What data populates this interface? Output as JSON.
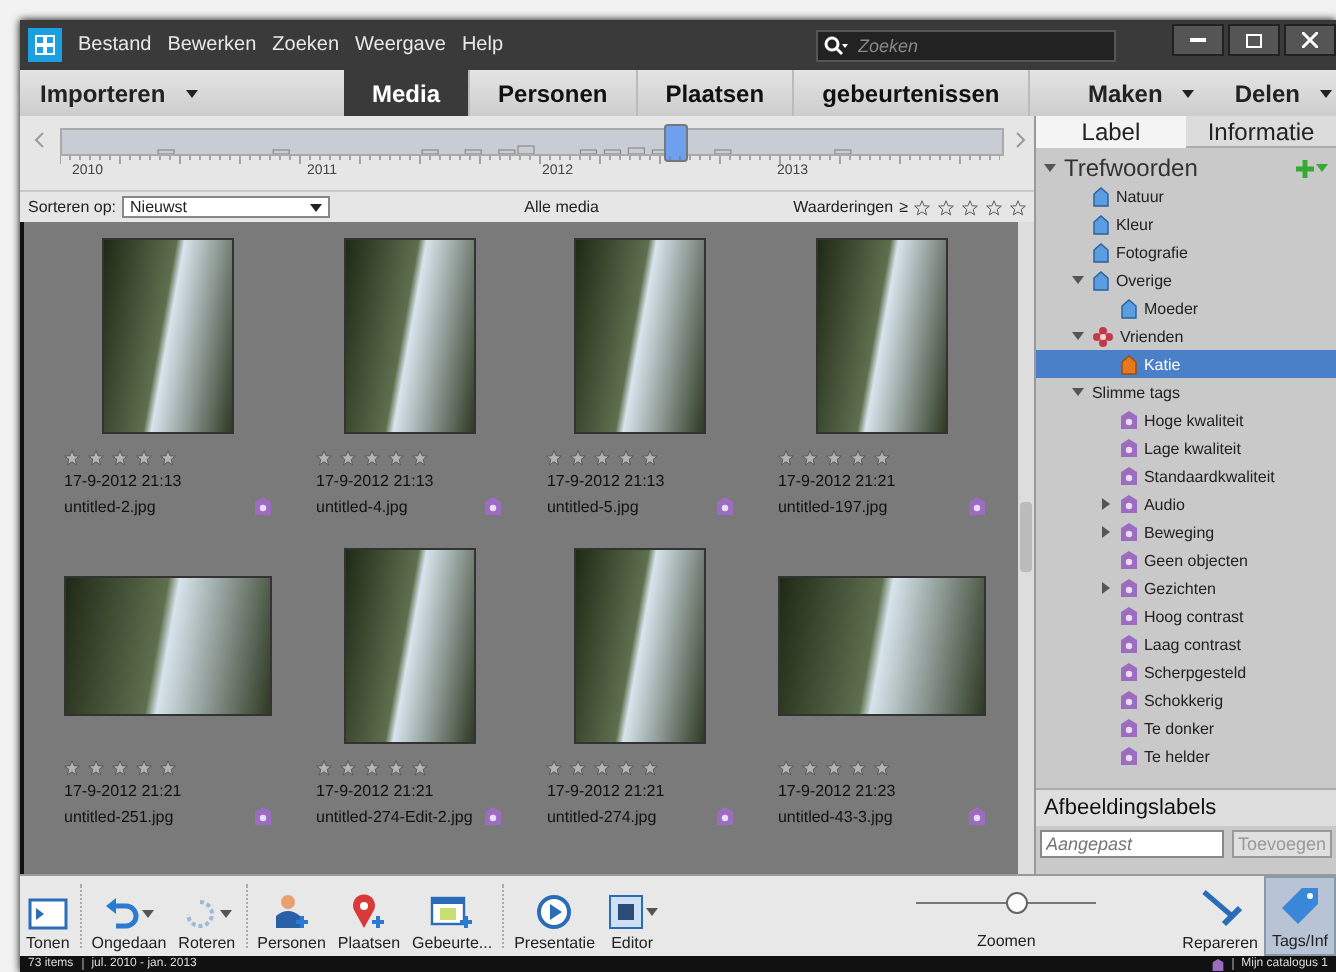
{
  "window": {
    "menu": [
      "Bestand",
      "Bewerken",
      "Zoeken",
      "Weergave",
      "Help"
    ],
    "search": {
      "placeholder": "Zoeken"
    }
  },
  "nav": {
    "import": "Importeren",
    "tabs": [
      {
        "label": "Media",
        "selected": true
      },
      {
        "label": "Personen",
        "selected": false
      },
      {
        "label": "Plaatsen",
        "selected": false
      },
      {
        "label": "gebeurtenissen",
        "selected": false
      }
    ],
    "create": "Maken",
    "share": "Delen"
  },
  "timeline": {
    "years": [
      "2010",
      "2011",
      "2012",
      "2013"
    ],
    "level": 0.65
  },
  "sortbar": {
    "label": "Sorteren op:",
    "sort": "Nieuwst",
    "title": "Alle media",
    "ratings_label": "Waarderingen",
    "ratings_op": "≥",
    "stars": 0
  },
  "media": [
    {
      "kind": "portrait",
      "stars": 0,
      "date": "17-9-2012 21:13",
      "file": "untitled-2.jpg"
    },
    {
      "kind": "portrait",
      "stars": 0,
      "date": "17-9-2012 21:13",
      "file": "untitled-4.jpg"
    },
    {
      "kind": "portrait",
      "stars": 0,
      "date": "17-9-2012 21:13",
      "file": "untitled-5.jpg"
    },
    {
      "kind": "portrait",
      "stars": 0,
      "date": "17-9-2012 21:21",
      "file": "untitled-197.jpg"
    },
    {
      "kind": "landscape",
      "stars": 0,
      "date": "17-9-2012 21:21",
      "file": "untitled-251.jpg"
    },
    {
      "kind": "portrait",
      "stars": 0,
      "date": "17-9-2012 21:21",
      "file": "untitled-274-Edit-2.jpg"
    },
    {
      "kind": "portrait",
      "stars": 0,
      "date": "17-9-2012 21:21",
      "file": "untitled-274.jpg"
    },
    {
      "kind": "landscape",
      "stars": 0,
      "date": "17-9-2012 21:23",
      "file": "untitled-43-3.jpg"
    }
  ],
  "panel": {
    "tabs": [
      {
        "label": "Label",
        "selected": true
      },
      {
        "label": "Informatie",
        "selected": false
      }
    ],
    "tree": [
      {
        "label": "Trefwoorden",
        "kind": "header",
        "expanded": true,
        "children": [
          {
            "label": "Natuur",
            "kind": "keyword",
            "selected": false
          },
          {
            "label": "Kleur",
            "kind": "keyword",
            "selected": false
          },
          {
            "label": "Fotografie",
            "kind": "keyword",
            "selected": false
          },
          {
            "label": "Overige",
            "kind": "keyword",
            "selected": false,
            "expanded": true,
            "children": [
              {
                "label": "Moeder",
                "kind": "keyword",
                "selected": false
              }
            ]
          },
          {
            "label": "Vrienden",
            "kind": "category",
            "selected": false,
            "expanded": true,
            "children": [
              {
                "label": "Katie",
                "kind": "keyword",
                "selected": true
              }
            ]
          },
          {
            "label": "Slimme tags",
            "kind": "group",
            "selected": false,
            "expanded": true,
            "children": [
              {
                "label": "Hoge kwaliteit",
                "kind": "smart",
                "selected": false
              },
              {
                "label": "Lage kwaliteit",
                "kind": "smart",
                "selected": false
              },
              {
                "label": "Standaardkwaliteit",
                "kind": "smart",
                "selected": false
              },
              {
                "label": "Audio",
                "kind": "smart",
                "selected": false,
                "expanded": false
              },
              {
                "label": "Beweging",
                "kind": "smart",
                "selected": false,
                "expanded": false
              },
              {
                "label": "Geen objecten",
                "kind": "smart",
                "selected": false
              },
              {
                "label": "Gezichten",
                "kind": "smart",
                "selected": false,
                "expanded": false
              },
              {
                "label": "Hoog contrast",
                "kind": "smart",
                "selected": false
              },
              {
                "label": "Laag contrast",
                "kind": "smart",
                "selected": false
              },
              {
                "label": "Scherpgesteld",
                "kind": "smart",
                "selected": false
              },
              {
                "label": "Schokkerig",
                "kind": "smart",
                "selected": false
              },
              {
                "label": "Te donker",
                "kind": "smart",
                "selected": false
              },
              {
                "label": "Te helder",
                "kind": "smart",
                "selected": false
              }
            ]
          }
        ]
      }
    ],
    "labels_title": "Afbeeldingslabels",
    "labels_field": {
      "placeholder": "Aangepast"
    },
    "labels_add": "Toevoegen"
  },
  "toolbar": {
    "tools": [
      {
        "kind": "show",
        "label": "Tonen",
        "menu": false
      },
      {
        "kind": "undo",
        "label": "Ongedaan",
        "menu": true
      },
      {
        "kind": "rotate",
        "label": "Roteren",
        "menu": true
      },
      {
        "kind": "people",
        "label": "Personen",
        "menu": false
      },
      {
        "kind": "places",
        "label": "Plaatsen",
        "menu": false
      },
      {
        "kind": "events",
        "label": "Gebeurte...",
        "menu": false
      },
      {
        "kind": "slideshow",
        "label": "Presentatie",
        "menu": false
      },
      {
        "kind": "editor",
        "label": "Editor",
        "menu": true
      }
    ],
    "zoom": {
      "label": "Zoomen",
      "level": 0.55
    },
    "right": [
      {
        "kind": "fix",
        "label": "Repareren",
        "selected": false
      },
      {
        "kind": "tags",
        "label": "Tags/Inf",
        "selected": true
      }
    ]
  },
  "status": {
    "count": "73 items",
    "range": "jul. 2010 - jan. 2013",
    "catalog": "Mijn catalogus 1"
  }
}
